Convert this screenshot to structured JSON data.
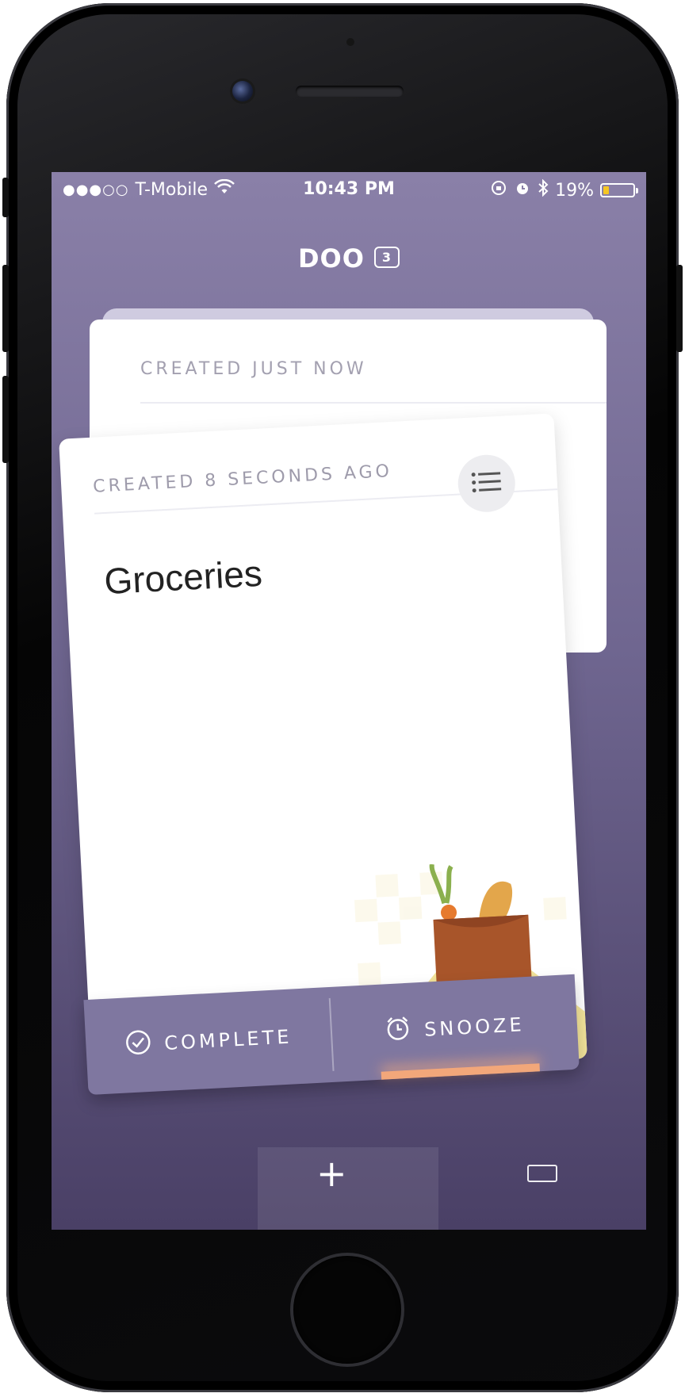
{
  "status_bar": {
    "signal": "●●●○○",
    "carrier": "T-Mobile",
    "time": "10:43 PM",
    "battery_percent": "19%",
    "battery_level": 0.19,
    "battery_color": "#f5c623"
  },
  "header": {
    "title": "DOO",
    "count_badge": "3"
  },
  "cards": {
    "back_card": {
      "created": "CREATED JUST NOW"
    },
    "front_card": {
      "created": "CREATED 8 SECONDS AGO",
      "title": "Groceries",
      "illustration": "groceries-bag-illustration"
    }
  },
  "actions": {
    "complete_label": "COMPLETE",
    "snooze_label": "SNOOZE"
  },
  "tab_bar": {
    "add_symbol": "+"
  },
  "colors": {
    "background_top": "#8a80a8",
    "background_bottom": "#4a4066",
    "action_bar": "#7f77a0"
  }
}
